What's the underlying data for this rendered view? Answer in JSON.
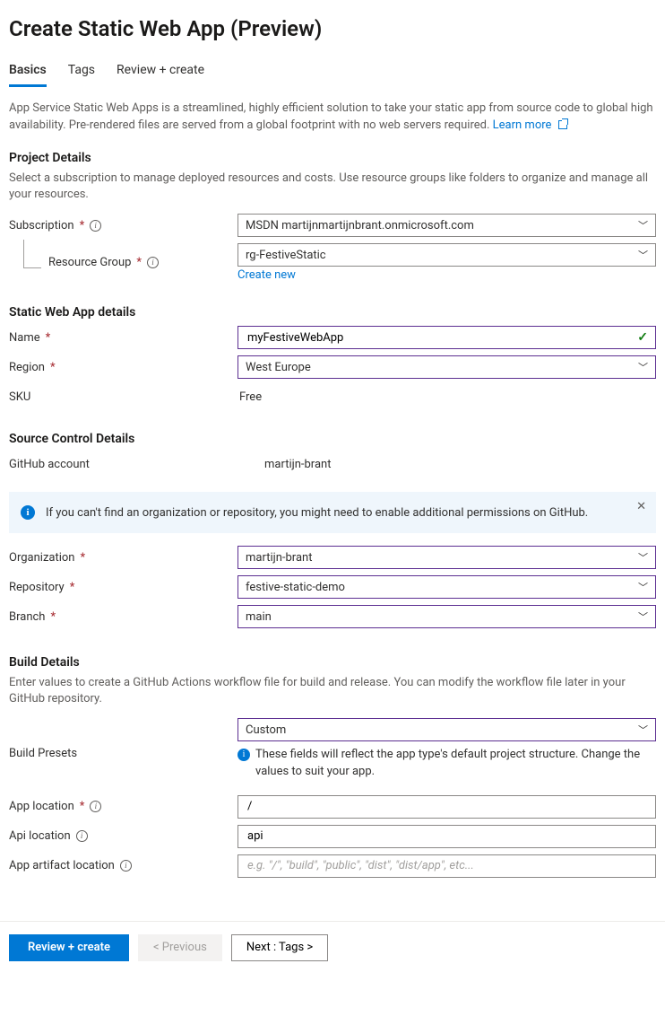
{
  "header": {
    "title": "Create Static Web App (Preview)"
  },
  "tabs": [
    {
      "label": "Basics",
      "active": true
    },
    {
      "label": "Tags",
      "active": false
    },
    {
      "label": "Review + create",
      "active": false
    }
  ],
  "intro": {
    "text": "App Service Static Web Apps is a streamlined, highly efficient solution to take your static app from source code to global high availability. Pre-rendered files are served from a global footprint with no web servers required.  ",
    "learn_more": "Learn more"
  },
  "project": {
    "title": "Project Details",
    "sub": "Select a subscription to manage deployed resources and costs. Use resource groups like folders to organize and manage all your resources.",
    "subscription_label": "Subscription",
    "subscription_value": "MSDN martijnmartijnbrant.onmicrosoft.com",
    "rg_label": "Resource Group",
    "rg_value": "rg-FestiveStatic",
    "create_new": "Create new"
  },
  "swa": {
    "title": "Static Web App details",
    "name_label": "Name",
    "name_value": "myFestiveWebApp",
    "region_label": "Region",
    "region_value": "West Europe",
    "sku_label": "SKU",
    "sku_value": "Free"
  },
  "source": {
    "title": "Source Control Details",
    "gh_account_label": "GitHub account",
    "gh_account_value": "martijn-brant",
    "banner": "If you can't find an organization or repository, you might need to enable additional permissions on GitHub.",
    "org_label": "Organization",
    "org_value": "martijn-brant",
    "repo_label": "Repository",
    "repo_value": "festive-static-demo",
    "branch_label": "Branch",
    "branch_value": "main"
  },
  "build": {
    "title": "Build Details",
    "sub": "Enter values to create a GitHub Actions workflow file for build and release. You can modify the workflow file later in your GitHub repository.",
    "preset_label": "Build Presets",
    "preset_value": "Custom",
    "preset_hint": "These fields will reflect the app type's default project structure. Change the values to suit your app.",
    "app_loc_label": "App location",
    "app_loc_value": "/",
    "api_loc_label": "Api location",
    "api_loc_value": "api",
    "artifact_label": "App artifact location",
    "artifact_placeholder": "e.g. \"/\", \"build\", \"public\", \"dist\", \"dist/app\", etc..."
  },
  "footer": {
    "review": "Review + create",
    "prev": "< Previous",
    "next": "Next : Tags >"
  }
}
